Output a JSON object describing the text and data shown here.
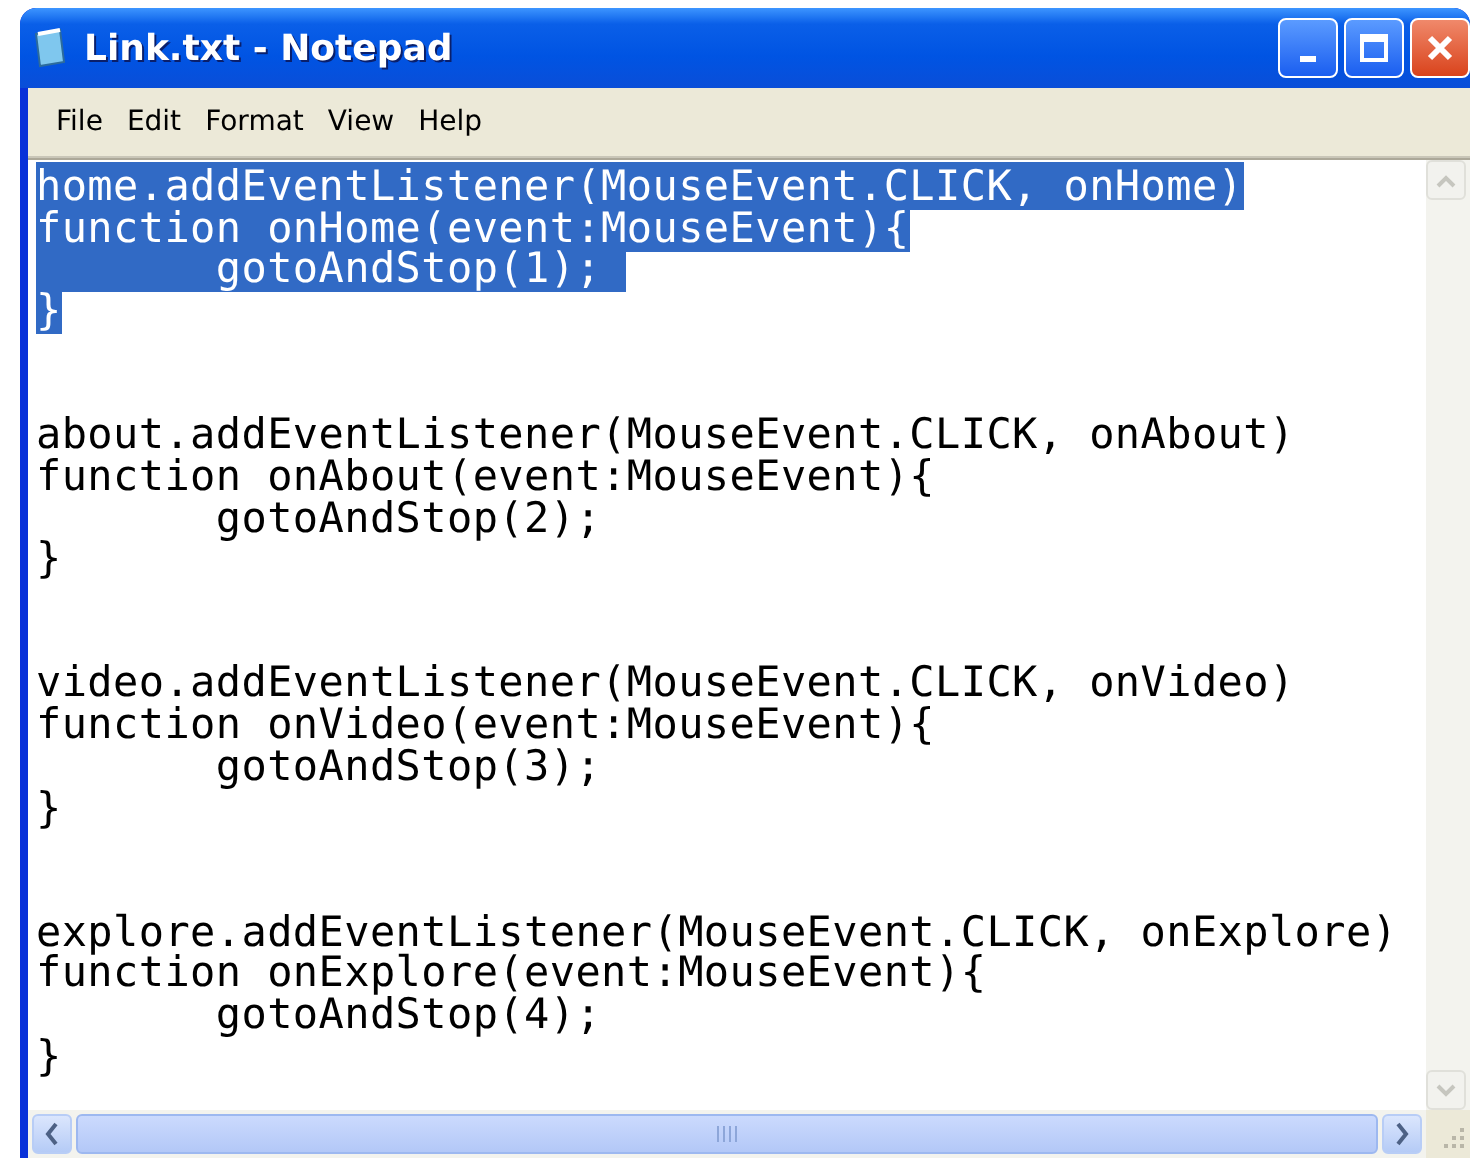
{
  "window": {
    "title": "Link.txt - Notepad"
  },
  "menu": [
    "File",
    "Edit",
    "Format",
    "View",
    "Help"
  ],
  "document": {
    "blocks": [
      {
        "selected": true,
        "lines": [
          "home.addEventListener(MouseEvent.CLICK, onHome)",
          "function onHome(event:MouseEvent){",
          "\tgotoAndStop(1); ",
          "}"
        ]
      },
      {
        "selected": false,
        "lines": [
          "about.addEventListener(MouseEvent.CLICK, onAbout)",
          "function onAbout(event:MouseEvent){",
          "\tgotoAndStop(2);",
          "}"
        ]
      },
      {
        "selected": false,
        "lines": [
          "video.addEventListener(MouseEvent.CLICK, onVideo)",
          "function onVideo(event:MouseEvent){",
          "\tgotoAndStop(3);",
          "}"
        ]
      },
      {
        "selected": false,
        "lines": [
          "explore.addEventListener(MouseEvent.CLICK, onExplore)",
          "function onExplore(event:MouseEvent){",
          "\tgotoAndStop(4);",
          "}"
        ]
      }
    ]
  }
}
